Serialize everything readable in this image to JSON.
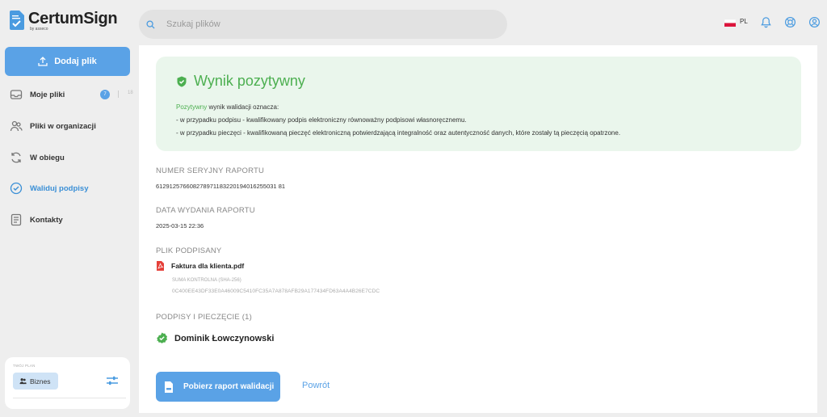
{
  "app": {
    "name": "CertumSign",
    "by": "by asseco"
  },
  "search": {
    "placeholder": "Szukaj plików"
  },
  "topbar": {
    "language": "PL"
  },
  "sidebar": {
    "add_button": "Dodaj plik",
    "items": [
      {
        "label": "Moje pliki",
        "badge": "7",
        "total": "18"
      },
      {
        "label": "Pliki w organizacji"
      },
      {
        "label": "W obiegu"
      },
      {
        "label": "Waliduj podpisy"
      },
      {
        "label": "Kontakty"
      }
    ],
    "plan": {
      "label": "TWÓJ PLAN",
      "name": "Biznes"
    }
  },
  "result": {
    "title": "Wynik pozytywny",
    "intro_highlight": "Pozytywny",
    "intro_rest": " wynik walidacji oznacza:",
    "line1": "- w przypadku podpisu - kwalifikowany podpis elektroniczny równoważny podpisowi własnoręcznemu.",
    "line2": "- w przypadku pieczęci - kwalifikowaną pieczęć elektroniczną potwierdzającą integralność oraz autentyczność danych, które zostały tą pieczęcią opatrzone."
  },
  "report": {
    "serial_label": "NUMER SERYJNY RAPORTU",
    "serial_value": "612912576608278971183220194016255031 81",
    "date_label": "DATA WYDANIA RAPORTU",
    "date_value": "2025-03-15 22:36",
    "file_label": "PLIK PODPISANY",
    "file_name": "Faktura dla klienta.pdf",
    "checksum_label": "SUMA KONTROLNA (SHA-256)",
    "checksum_value": "0C400EE43DF33E0A46009C5410FC35A7A878AFB29A177434FD63A4A4B26E7CDC",
    "signatures_label": "PODPISY I PIECZĘCIE (1)",
    "signer": "Dominik Łowczynowski"
  },
  "actions": {
    "download": "Pobierz raport walidacji",
    "back": "Powrót"
  },
  "colors": {
    "accent": "#5aa2e6",
    "success": "#4caf50",
    "success_bg": "#eaf6ec"
  }
}
